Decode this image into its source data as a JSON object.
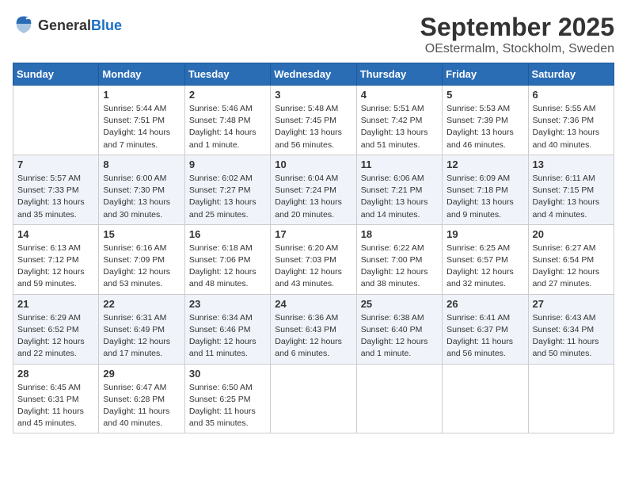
{
  "logo": {
    "text_general": "General",
    "text_blue": "Blue"
  },
  "header": {
    "month": "September 2025",
    "location": "OEstermalm, Stockholm, Sweden"
  },
  "days_of_week": [
    "Sunday",
    "Monday",
    "Tuesday",
    "Wednesday",
    "Thursday",
    "Friday",
    "Saturday"
  ],
  "weeks": [
    [
      {
        "day": "",
        "sunrise": "",
        "sunset": "",
        "daylight": ""
      },
      {
        "day": "1",
        "sunrise": "Sunrise: 5:44 AM",
        "sunset": "Sunset: 7:51 PM",
        "daylight": "Daylight: 14 hours and 7 minutes."
      },
      {
        "day": "2",
        "sunrise": "Sunrise: 5:46 AM",
        "sunset": "Sunset: 7:48 PM",
        "daylight": "Daylight: 14 hours and 1 minute."
      },
      {
        "day": "3",
        "sunrise": "Sunrise: 5:48 AM",
        "sunset": "Sunset: 7:45 PM",
        "daylight": "Daylight: 13 hours and 56 minutes."
      },
      {
        "day": "4",
        "sunrise": "Sunrise: 5:51 AM",
        "sunset": "Sunset: 7:42 PM",
        "daylight": "Daylight: 13 hours and 51 minutes."
      },
      {
        "day": "5",
        "sunrise": "Sunrise: 5:53 AM",
        "sunset": "Sunset: 7:39 PM",
        "daylight": "Daylight: 13 hours and 46 minutes."
      },
      {
        "day": "6",
        "sunrise": "Sunrise: 5:55 AM",
        "sunset": "Sunset: 7:36 PM",
        "daylight": "Daylight: 13 hours and 40 minutes."
      }
    ],
    [
      {
        "day": "7",
        "sunrise": "Sunrise: 5:57 AM",
        "sunset": "Sunset: 7:33 PM",
        "daylight": "Daylight: 13 hours and 35 minutes."
      },
      {
        "day": "8",
        "sunrise": "Sunrise: 6:00 AM",
        "sunset": "Sunset: 7:30 PM",
        "daylight": "Daylight: 13 hours and 30 minutes."
      },
      {
        "day": "9",
        "sunrise": "Sunrise: 6:02 AM",
        "sunset": "Sunset: 7:27 PM",
        "daylight": "Daylight: 13 hours and 25 minutes."
      },
      {
        "day": "10",
        "sunrise": "Sunrise: 6:04 AM",
        "sunset": "Sunset: 7:24 PM",
        "daylight": "Daylight: 13 hours and 20 minutes."
      },
      {
        "day": "11",
        "sunrise": "Sunrise: 6:06 AM",
        "sunset": "Sunset: 7:21 PM",
        "daylight": "Daylight: 13 hours and 14 minutes."
      },
      {
        "day": "12",
        "sunrise": "Sunrise: 6:09 AM",
        "sunset": "Sunset: 7:18 PM",
        "daylight": "Daylight: 13 hours and 9 minutes."
      },
      {
        "day": "13",
        "sunrise": "Sunrise: 6:11 AM",
        "sunset": "Sunset: 7:15 PM",
        "daylight": "Daylight: 13 hours and 4 minutes."
      }
    ],
    [
      {
        "day": "14",
        "sunrise": "Sunrise: 6:13 AM",
        "sunset": "Sunset: 7:12 PM",
        "daylight": "Daylight: 12 hours and 59 minutes."
      },
      {
        "day": "15",
        "sunrise": "Sunrise: 6:16 AM",
        "sunset": "Sunset: 7:09 PM",
        "daylight": "Daylight: 12 hours and 53 minutes."
      },
      {
        "day": "16",
        "sunrise": "Sunrise: 6:18 AM",
        "sunset": "Sunset: 7:06 PM",
        "daylight": "Daylight: 12 hours and 48 minutes."
      },
      {
        "day": "17",
        "sunrise": "Sunrise: 6:20 AM",
        "sunset": "Sunset: 7:03 PM",
        "daylight": "Daylight: 12 hours and 43 minutes."
      },
      {
        "day": "18",
        "sunrise": "Sunrise: 6:22 AM",
        "sunset": "Sunset: 7:00 PM",
        "daylight": "Daylight: 12 hours and 38 minutes."
      },
      {
        "day": "19",
        "sunrise": "Sunrise: 6:25 AM",
        "sunset": "Sunset: 6:57 PM",
        "daylight": "Daylight: 12 hours and 32 minutes."
      },
      {
        "day": "20",
        "sunrise": "Sunrise: 6:27 AM",
        "sunset": "Sunset: 6:54 PM",
        "daylight": "Daylight: 12 hours and 27 minutes."
      }
    ],
    [
      {
        "day": "21",
        "sunrise": "Sunrise: 6:29 AM",
        "sunset": "Sunset: 6:52 PM",
        "daylight": "Daylight: 12 hours and 22 minutes."
      },
      {
        "day": "22",
        "sunrise": "Sunrise: 6:31 AM",
        "sunset": "Sunset: 6:49 PM",
        "daylight": "Daylight: 12 hours and 17 minutes."
      },
      {
        "day": "23",
        "sunrise": "Sunrise: 6:34 AM",
        "sunset": "Sunset: 6:46 PM",
        "daylight": "Daylight: 12 hours and 11 minutes."
      },
      {
        "day": "24",
        "sunrise": "Sunrise: 6:36 AM",
        "sunset": "Sunset: 6:43 PM",
        "daylight": "Daylight: 12 hours and 6 minutes."
      },
      {
        "day": "25",
        "sunrise": "Sunrise: 6:38 AM",
        "sunset": "Sunset: 6:40 PM",
        "daylight": "Daylight: 12 hours and 1 minute."
      },
      {
        "day": "26",
        "sunrise": "Sunrise: 6:41 AM",
        "sunset": "Sunset: 6:37 PM",
        "daylight": "Daylight: 11 hours and 56 minutes."
      },
      {
        "day": "27",
        "sunrise": "Sunrise: 6:43 AM",
        "sunset": "Sunset: 6:34 PM",
        "daylight": "Daylight: 11 hours and 50 minutes."
      }
    ],
    [
      {
        "day": "28",
        "sunrise": "Sunrise: 6:45 AM",
        "sunset": "Sunset: 6:31 PM",
        "daylight": "Daylight: 11 hours and 45 minutes."
      },
      {
        "day": "29",
        "sunrise": "Sunrise: 6:47 AM",
        "sunset": "Sunset: 6:28 PM",
        "daylight": "Daylight: 11 hours and 40 minutes."
      },
      {
        "day": "30",
        "sunrise": "Sunrise: 6:50 AM",
        "sunset": "Sunset: 6:25 PM",
        "daylight": "Daylight: 11 hours and 35 minutes."
      },
      {
        "day": "",
        "sunrise": "",
        "sunset": "",
        "daylight": ""
      },
      {
        "day": "",
        "sunrise": "",
        "sunset": "",
        "daylight": ""
      },
      {
        "day": "",
        "sunrise": "",
        "sunset": "",
        "daylight": ""
      },
      {
        "day": "",
        "sunrise": "",
        "sunset": "",
        "daylight": ""
      }
    ]
  ]
}
